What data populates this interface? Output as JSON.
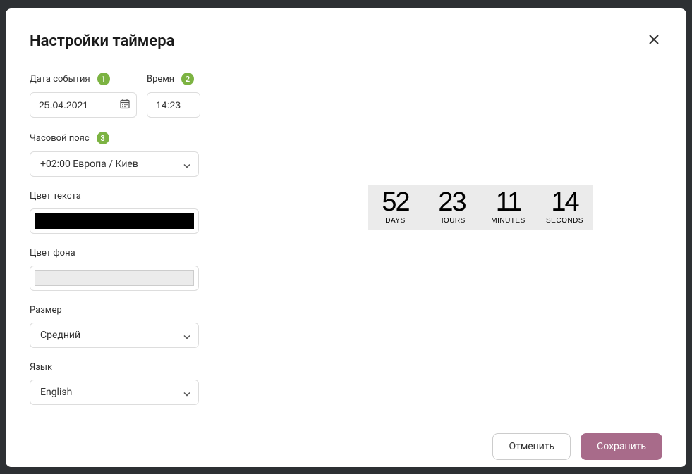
{
  "modal": {
    "title": "Настройки таймера"
  },
  "labels": {
    "event_date": "Дата события",
    "time": "Время",
    "timezone": "Часовой пояс",
    "text_color": "Цвет текста",
    "bg_color": "Цвет фона",
    "size": "Размер",
    "language": "Язык"
  },
  "badges": {
    "date": "1",
    "time": "2",
    "timezone": "3"
  },
  "form": {
    "date": "25.04.2021",
    "time": "14:23",
    "timezone": "+02:00 Европа / Киев",
    "text_color": "#000000",
    "bg_color": "#ebebeb",
    "size": "Средний",
    "language": "English"
  },
  "countdown": {
    "days": {
      "value": "52",
      "label": "DAYS"
    },
    "hours": {
      "value": "23",
      "label": "HOURS"
    },
    "minutes": {
      "value": "11",
      "label": "MINUTES"
    },
    "seconds": {
      "value": "14",
      "label": "SECONDS"
    }
  },
  "footer": {
    "cancel": "Отменить",
    "save": "Сохранить"
  }
}
